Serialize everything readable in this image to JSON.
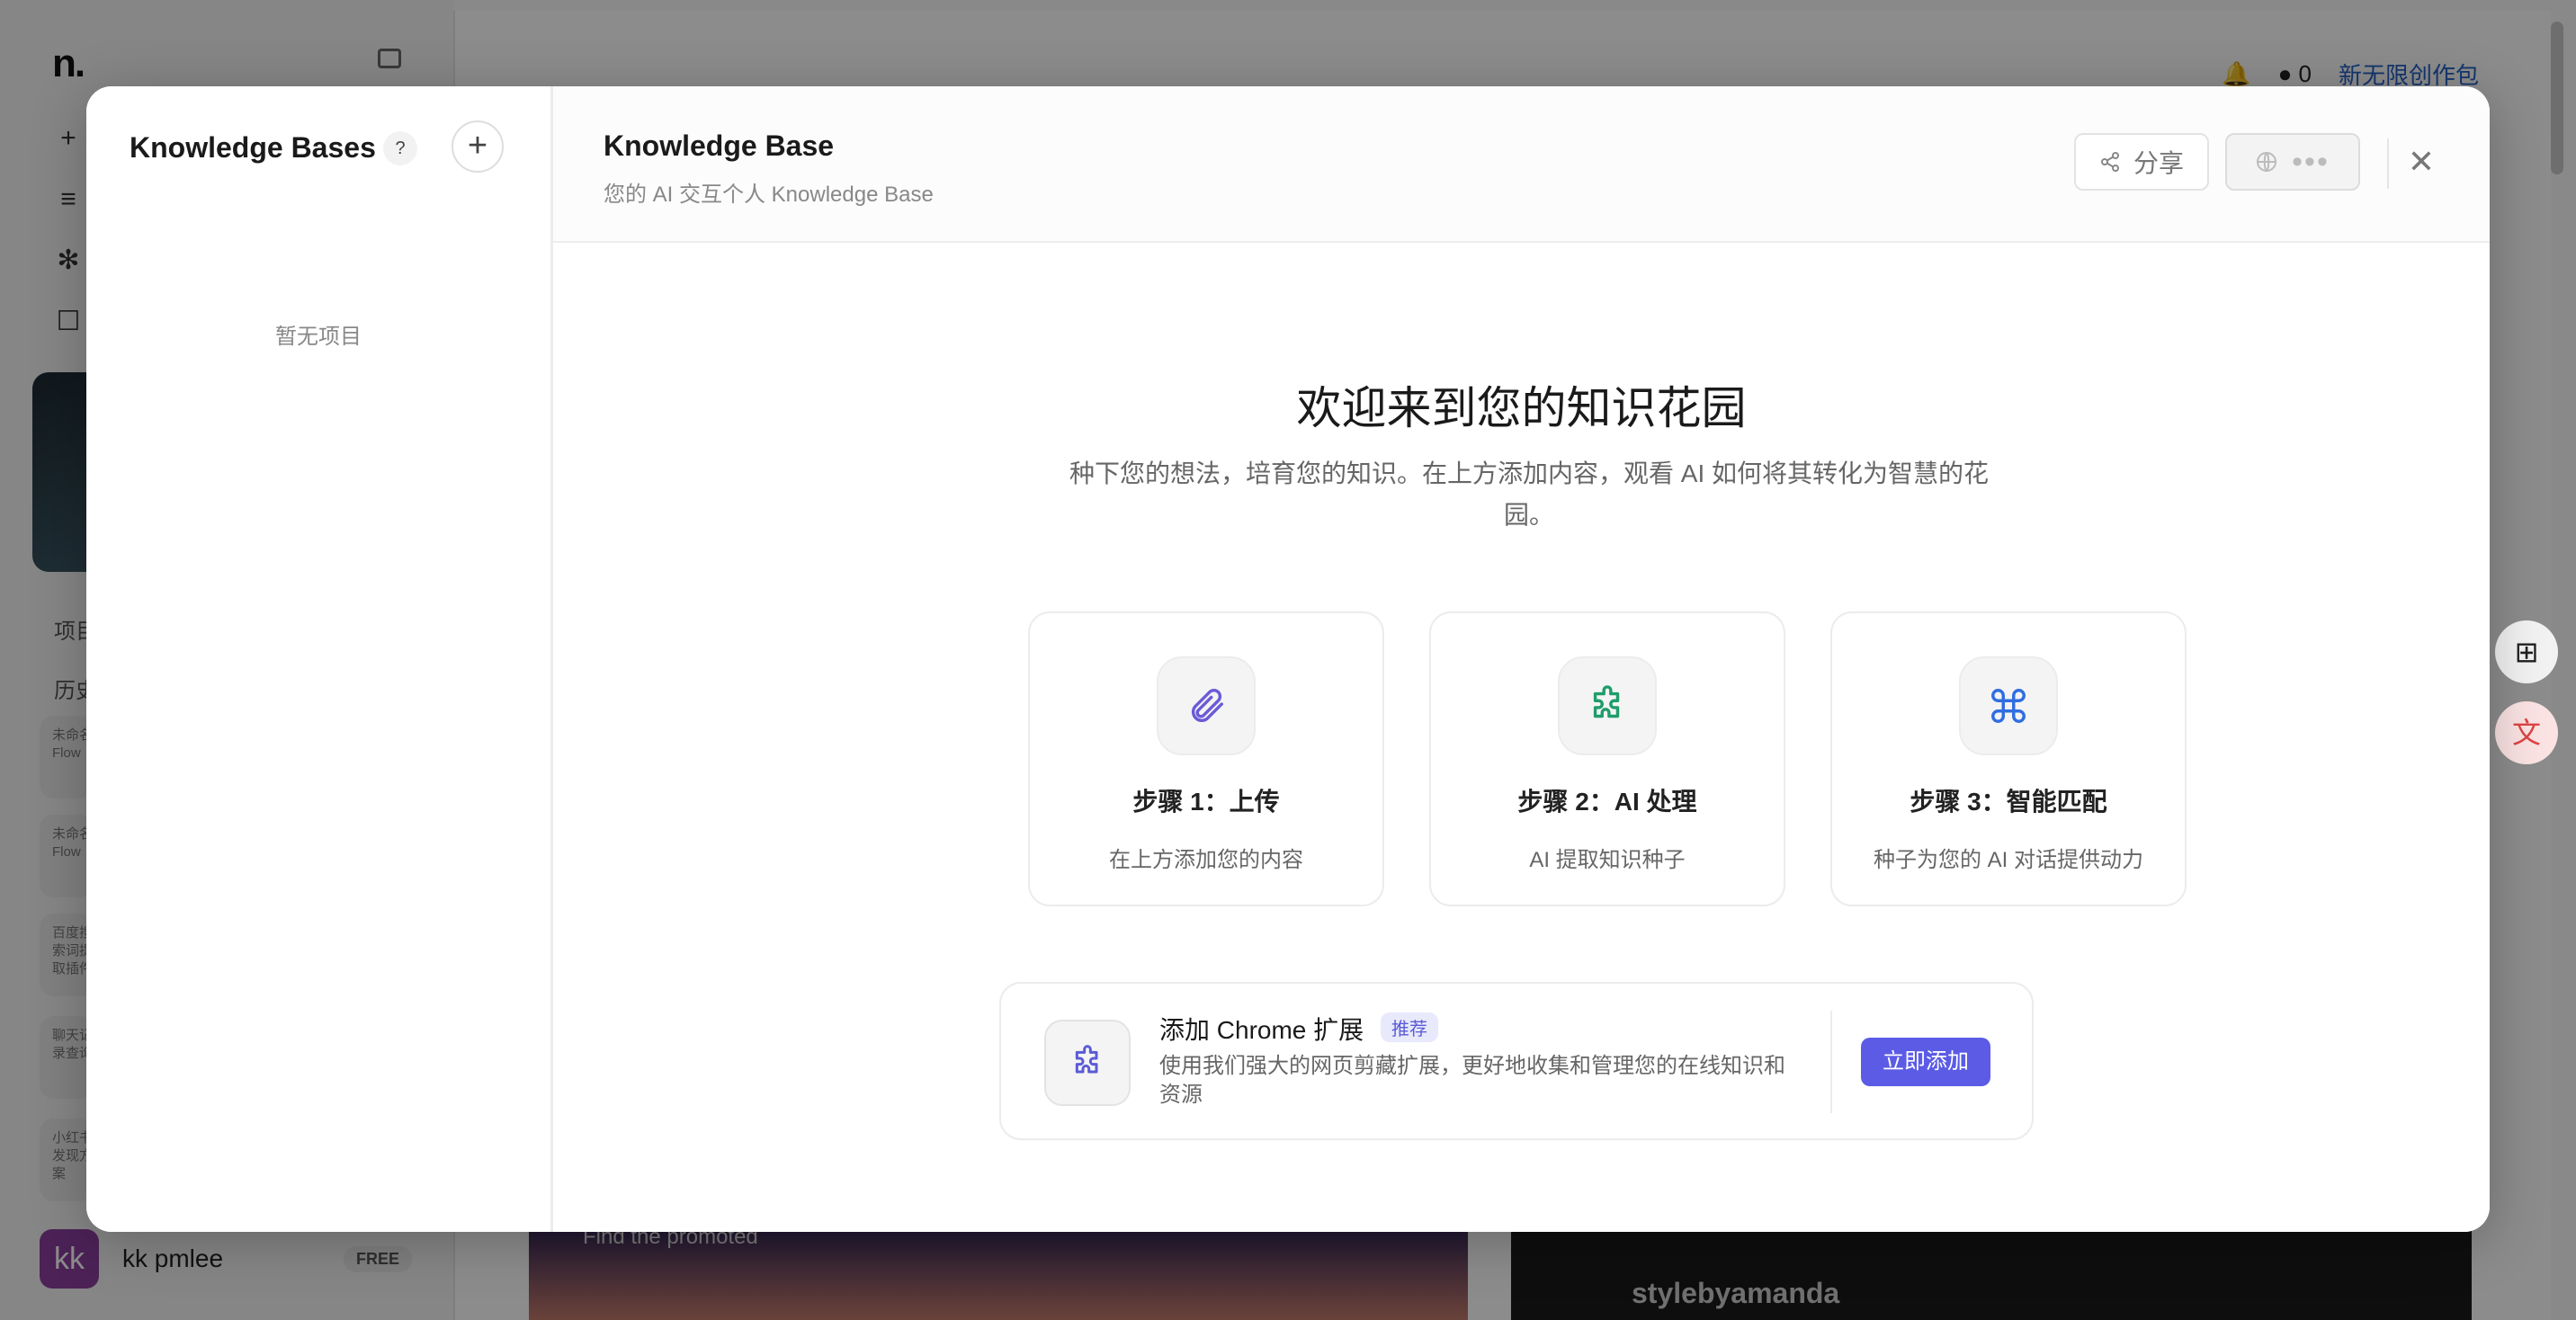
{
  "background": {
    "logo": "n.",
    "sidebar_sections": [
      "项目",
      "历史"
    ],
    "history_items": [
      "未命名 Flow",
      "未命名 Flow",
      "百度搜索词提取插件",
      "聊天记录查询",
      "小红书发现方案"
    ],
    "user_initials": "kk",
    "user_name": "kk pmlee",
    "plan_badge": "FREE",
    "credits": "0",
    "promo": "新无限创作包",
    "feed_caption": "Find the promoted",
    "feed_user": "stylebyamanda"
  },
  "modal": {
    "left_title": "Knowledge Bases",
    "empty_text": "暂无项目",
    "title": "Knowledge Base",
    "subtitle": "您的 AI 交互个人 Knowledge Base",
    "share_label": "分享",
    "welcome_title": "欢迎来到您的知识花园",
    "welcome_subtitle": "种下您的想法，培育您的知识。在上方添加内容，观看 AI 如何将其转化为智慧的花园。",
    "steps": [
      {
        "title": "步骤 1：上传",
        "desc": "在上方添加您的内容",
        "icon": "paperclip-icon"
      },
      {
        "title": "步骤 2：AI 处理",
        "desc": "AI 提取知识种子",
        "icon": "puzzle-icon"
      },
      {
        "title": "步骤 3：智能匹配",
        "desc": "种子为您的 AI 对话提供动力",
        "icon": "command-icon"
      }
    ],
    "extension": {
      "title": "添加 Chrome 扩展",
      "tag": "推荐",
      "desc": "使用我们强大的网页剪藏扩展，更好地收集和管理您的在线知识和资源",
      "button": "立即添加"
    }
  },
  "colors": {
    "accent": "#5b5be6",
    "step1_icon": "#6b5bd6",
    "step2_icon": "#1f9d6b",
    "step3_icon": "#2f6ee0"
  }
}
